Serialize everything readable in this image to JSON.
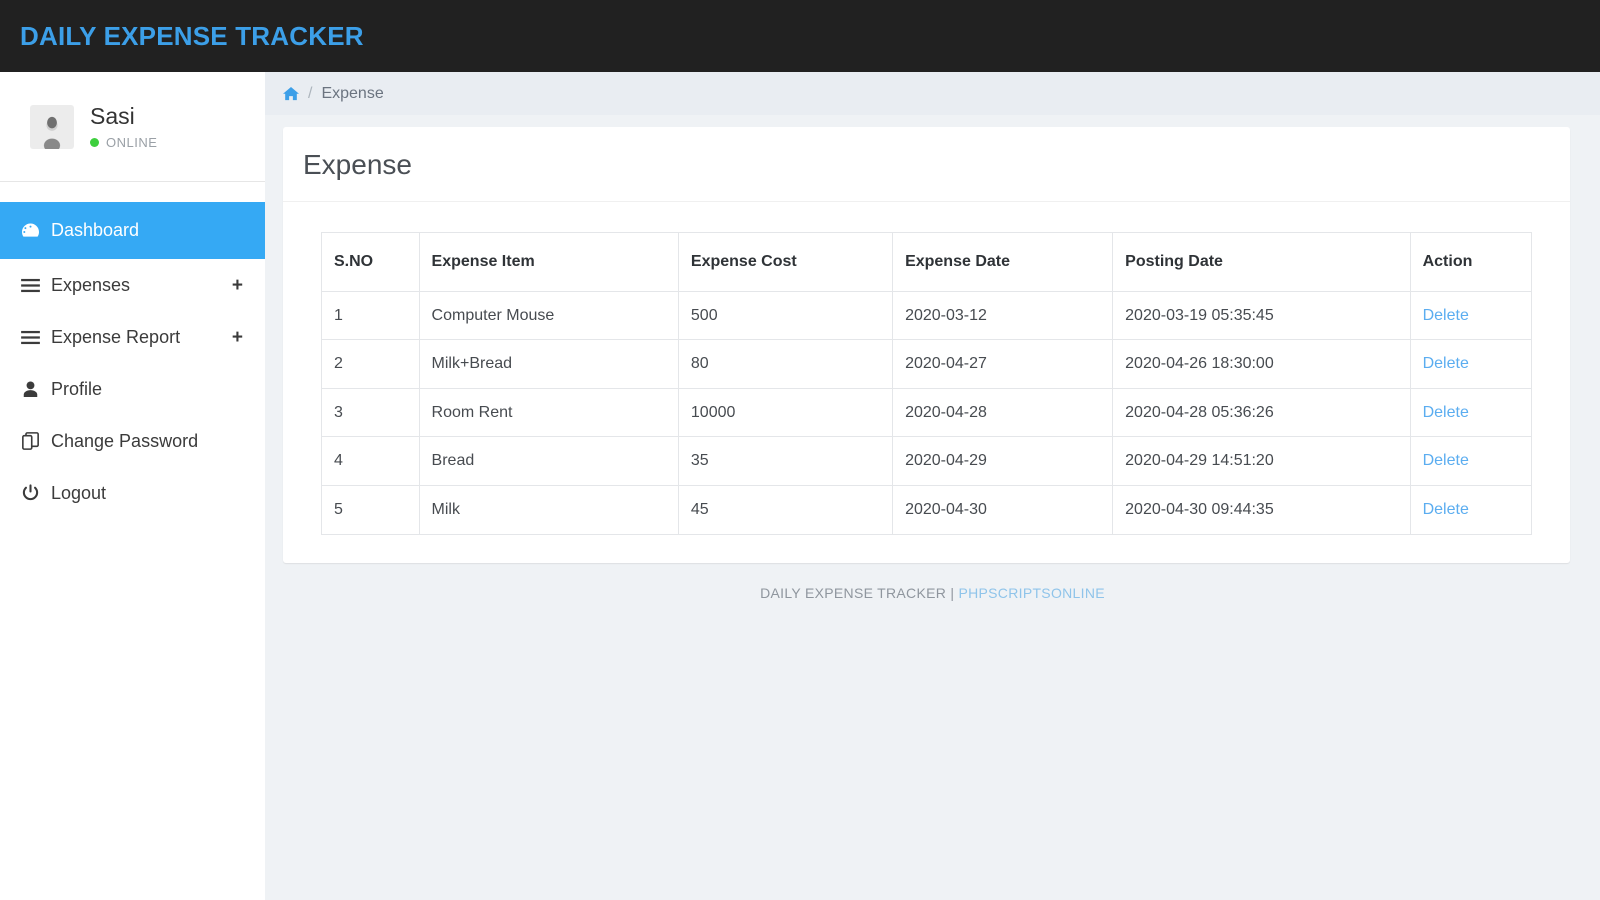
{
  "header": {
    "brand": "DAILY EXPENSE TRACKER",
    "brand_color": "#3c9fe8",
    "background": "#212121"
  },
  "sidebar": {
    "user": {
      "name": "Sasi",
      "status": "ONLINE",
      "status_color": "#3ecf3e",
      "avatar_icon": "user-photo-avatar"
    },
    "items": [
      {
        "label": "Dashboard",
        "icon": "tachometer-icon",
        "active": true,
        "has_plus": false,
        "plus": ""
      },
      {
        "label": "Expenses",
        "icon": "bars-icon",
        "active": false,
        "has_plus": true,
        "plus": "+"
      },
      {
        "label": "Expense Report",
        "icon": "bars-icon",
        "active": false,
        "has_plus": true,
        "plus": "+"
      },
      {
        "label": "Profile",
        "icon": "user-icon",
        "active": false,
        "has_plus": false,
        "plus": ""
      },
      {
        "label": "Change Password",
        "icon": "copy-icon",
        "active": false,
        "has_plus": false,
        "plus": ""
      },
      {
        "label": "Logout",
        "icon": "power-off-icon",
        "active": false,
        "has_plus": false,
        "plus": ""
      }
    ],
    "active_color": "#35a9f4"
  },
  "breadcrumb": {
    "home_icon": "home-icon",
    "separator": "/",
    "current": "Expense"
  },
  "main": {
    "page_title": "Expense",
    "table": {
      "columns": [
        "S.NO",
        "Expense Item",
        "Expense Cost",
        "Expense Date",
        "Posting Date",
        "Action"
      ],
      "rows": [
        {
          "sno": "1",
          "item": "Computer Mouse",
          "cost": "500",
          "expense_date": "2020-03-12",
          "posting_date": "2020-03-19 05:35:45",
          "action": "Delete"
        },
        {
          "sno": "2",
          "item": "Milk+Bread",
          "cost": "80",
          "expense_date": "2020-04-27",
          "posting_date": "2020-04-26 18:30:00",
          "action": "Delete"
        },
        {
          "sno": "3",
          "item": "Room Rent",
          "cost": "10000",
          "expense_date": "2020-04-28",
          "posting_date": "2020-04-28 05:36:26",
          "action": "Delete"
        },
        {
          "sno": "4",
          "item": "Bread",
          "cost": "35",
          "expense_date": "2020-04-29",
          "posting_date": "2020-04-29 14:51:20",
          "action": "Delete"
        },
        {
          "sno": "5",
          "item": "Milk",
          "cost": "45",
          "expense_date": "2020-04-30",
          "posting_date": "2020-04-30 09:44:35",
          "action": "Delete"
        }
      ]
    }
  },
  "footer": {
    "text": "DAILY EXPENSE TRACKER | ",
    "link": "PHPSCRIPTSONLINE",
    "link_color": "#8fc4ea"
  }
}
